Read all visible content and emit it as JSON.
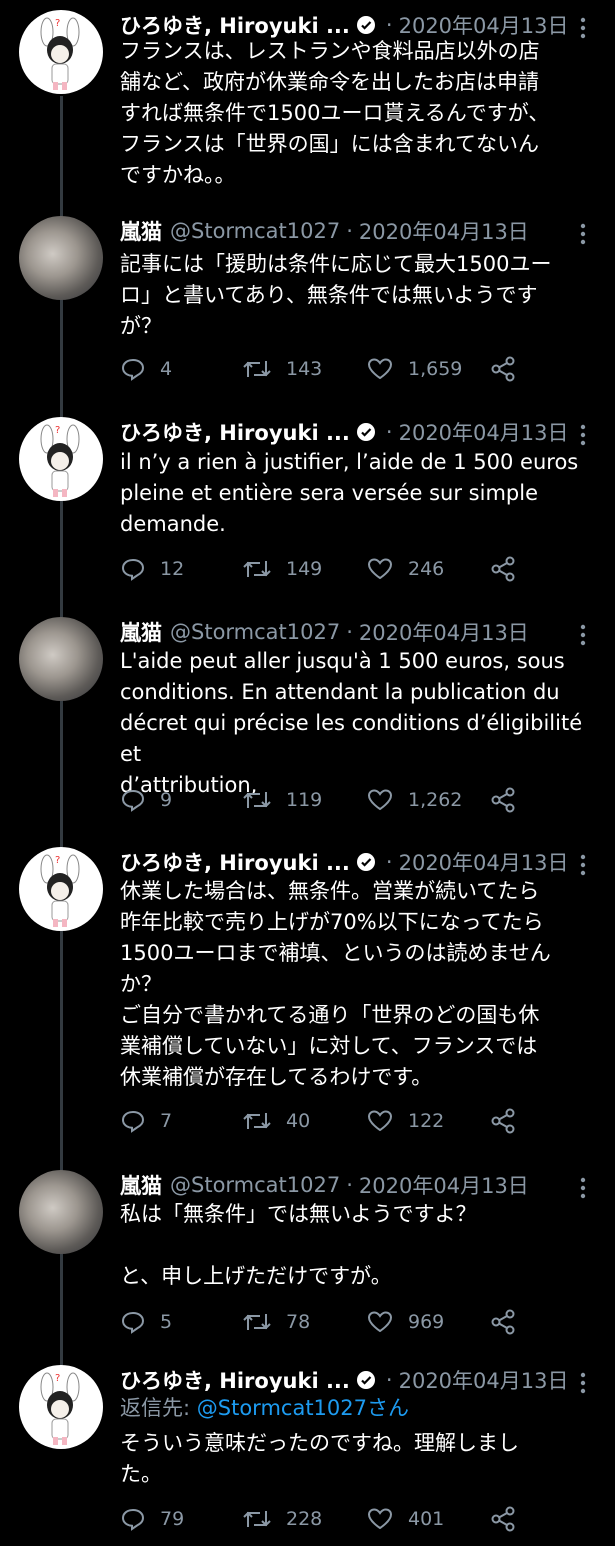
{
  "tweets": [
    {
      "name": "ひろゆき, Hiroyuki ...",
      "verified": true,
      "handle": "",
      "date": "2020年04月13日",
      "body": "フランスは、レストランや食料品店以外の店\n舗など、政府が休業命令を出したお店は申請\nすれば無条件で1500ユーロ貰えるんですが、\nフランスは「世界の国」には含まれてないん\nですかね。。",
      "stats": null
    },
    {
      "name": "嵐猫",
      "verified": false,
      "handle": "@Stormcat1027",
      "date": "2020年04月13日",
      "body": "記事には「援助は条件に応じて最大1500ユー\nロ」と書いてあり、無条件では無いようです\nが？",
      "stats": {
        "replies": "4",
        "retweets": "143",
        "likes": "1,659"
      }
    },
    {
      "name": "ひろゆき, Hiroyuki ...",
      "verified": true,
      "handle": "",
      "date": "2020年04月13日",
      "body": "il n’y a rien à justifier, l’aide de 1 500 euros\npleine et entière sera versée sur simple\ndemande.",
      "stats": {
        "replies": "12",
        "retweets": "149",
        "likes": "246"
      }
    },
    {
      "name": "嵐猫",
      "verified": false,
      "handle": "@Stormcat1027",
      "date": "2020年04月13日",
      "body": "L'aide peut aller jusqu'à 1 500 euros, sous\nconditions. En attendant la publication du\ndécret qui précise les conditions d’éligibilité et\nd’attribution,",
      "stats": {
        "replies": "9",
        "retweets": "119",
        "likes": "1,262"
      }
    },
    {
      "name": "ひろゆき, Hiroyuki ...",
      "verified": true,
      "handle": "",
      "date": "2020年04月13日",
      "body": "休業した場合は、無条件。営業が続いてたら\n昨年比較で売り上げが70%以下になってたら\n1500ユーロまで補填、というのは読めません\nか？\nご自分で書かれてる通り「世界のどの国も休\n業補償していない」に対して、フランスでは\n休業補償が存在してるわけです。",
      "stats": {
        "replies": "7",
        "retweets": "40",
        "likes": "122"
      }
    },
    {
      "name": "嵐猫",
      "verified": false,
      "handle": "@Stormcat1027",
      "date": "2020年04月13日",
      "body": "私は「無条件」では無いようですよ？\n\nと、申し上げただけですが。",
      "stats": {
        "replies": "5",
        "retweets": "78",
        "likes": "969"
      }
    },
    {
      "name": "ひろゆき, Hiroyuki ...",
      "verified": true,
      "handle": "",
      "date": "2020年04月13日",
      "reply_label": "返信先: ",
      "reply_mention": "@Stormcat1027さん",
      "body": "そういう意味だったのですね。理解しまし\nた。",
      "stats": {
        "replies": "79",
        "retweets": "228",
        "likes": "401"
      }
    }
  ],
  "colors": {
    "background": "#000000",
    "text": "#ffffff",
    "muted": "#8b98a5",
    "link": "#1d9bf0"
  }
}
